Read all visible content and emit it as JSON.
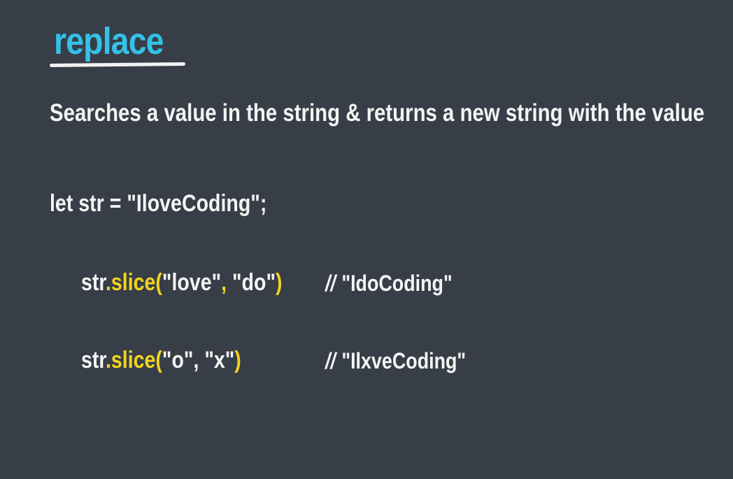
{
  "slide": {
    "title": "replace",
    "description": "Searches a value in the string & returns a new string with the value",
    "declaration": "let str = \"IloveCoding\";",
    "examples": [
      {
        "object": "str",
        "method": ".slice(",
        "arg1": "\"love\"",
        "separator": ",",
        "arg2": " \"do\"",
        "close": ")",
        "comment_marker": "//",
        "result": "\"IdoCoding\""
      },
      {
        "object": "str",
        "method": ".slice(",
        "arg1": "\"o\"",
        "separator": ",",
        "arg2": " \"x\"",
        "close": ")",
        "comment_marker": "//",
        "result": "\"IlxveCoding\""
      }
    ]
  },
  "colors": {
    "background": "#373e47",
    "title": "#34c1ea",
    "text": "#f4f4f4",
    "method_highlight": "#f2d21f"
  }
}
